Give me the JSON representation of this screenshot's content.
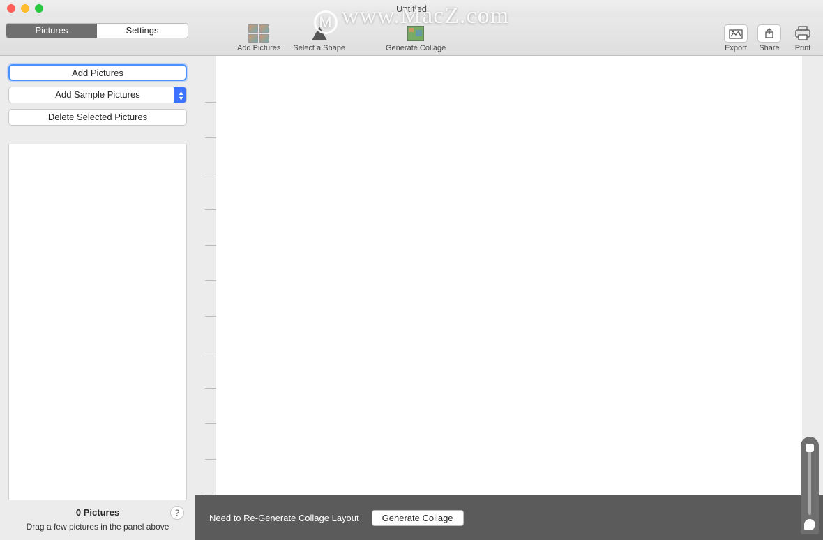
{
  "window": {
    "title": "Untitled"
  },
  "watermark": "www.MacZ.com",
  "tabs": {
    "pictures": "Pictures",
    "settings": "Settings"
  },
  "toolbar": {
    "add_pictures": "Add Pictures",
    "select_shape": "Select a Shape",
    "generate_collage": "Generate Collage",
    "export": "Export",
    "share": "Share",
    "print": "Print"
  },
  "sidebar": {
    "add_pictures": "Add Pictures",
    "add_sample": "Add Sample Pictures",
    "delete_selected": "Delete Selected Pictures",
    "count_label": "0 Pictures",
    "hint": "Drag a few pictures in the panel above",
    "help": "?"
  },
  "bottom": {
    "message": "Need to Re-Generate Collage Layout",
    "button": "Generate Collage"
  }
}
